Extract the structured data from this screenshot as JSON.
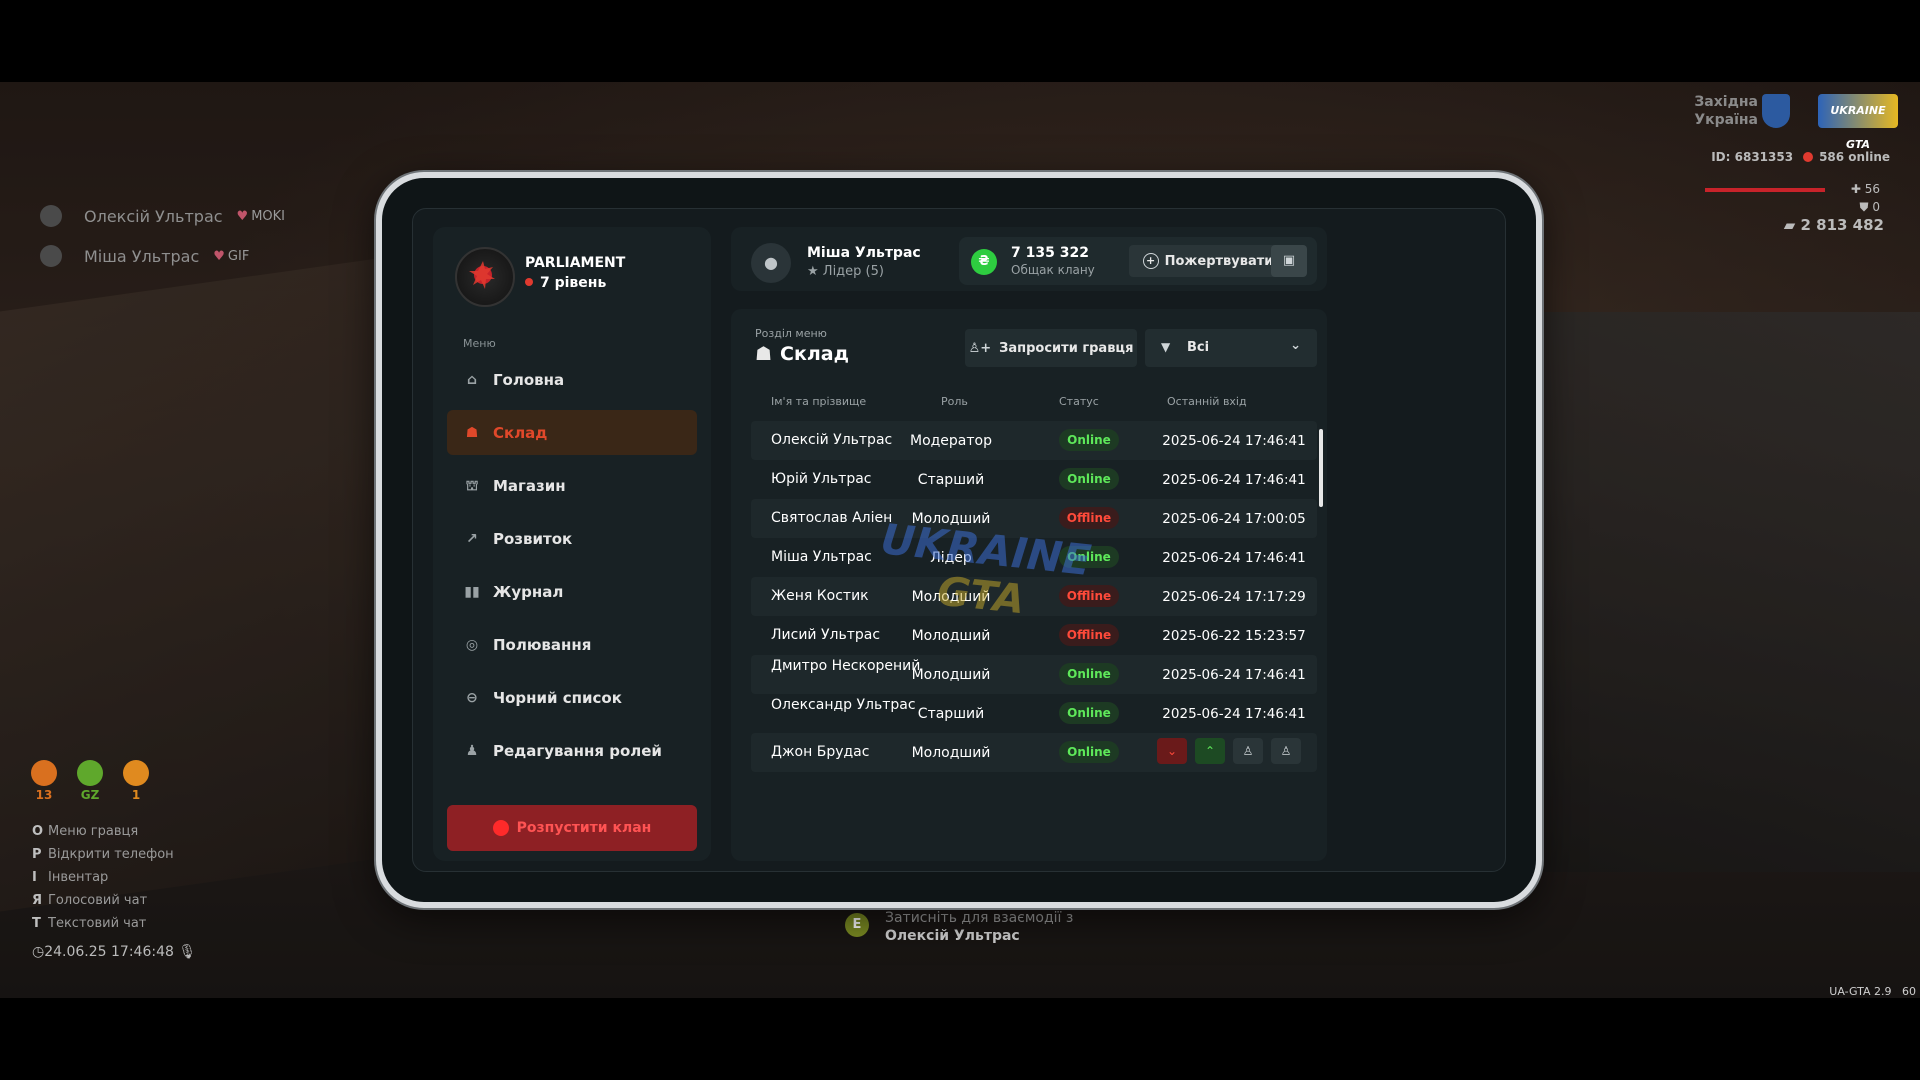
{
  "hud": {
    "region": "Західна\nУкраїна",
    "logo": "UKRAINE GTA",
    "player_id": "ID: 6831353",
    "online": "586 online",
    "health": "56",
    "armor": "0",
    "money": "2 813 482",
    "stats": [
      {
        "value": "13",
        "color": "#d9701f"
      },
      {
        "value": "GZ",
        "color": "#5fa82c"
      },
      {
        "value": "1",
        "color": "#e08a1f"
      }
    ],
    "keys": [
      {
        "key": "O",
        "label": "Меню гравця"
      },
      {
        "key": "P",
        "label": "Відкрити телефон"
      },
      {
        "key": "I",
        "label": "Інвентар"
      },
      {
        "key": "Я",
        "label": "Голосовий чат"
      },
      {
        "key": "T",
        "label": "Текстовий чат"
      }
    ],
    "clock": "24.06.25 17:46:48",
    "version": "UA-GTA 2.9   60"
  },
  "chat": [
    {
      "name": "Олексій Ультрас",
      "tag": "MOKI"
    },
    {
      "name": "Міша Ультрас",
      "tag": "GIF"
    }
  ],
  "prompt": {
    "key": "E",
    "line1": "Затисніть для взаємодії з",
    "line2": "Олексій Ультрас"
  },
  "clan": {
    "name": "PARLIAMENT",
    "level": "7 рівень"
  },
  "menu": {
    "label": "Меню",
    "items": [
      {
        "label": "Головна",
        "icon": "home-icon",
        "active": false
      },
      {
        "label": "Склад",
        "icon": "members-icon",
        "active": true
      },
      {
        "label": "Магазин",
        "icon": "shop-icon",
        "active": false
      },
      {
        "label": "Розвиток",
        "icon": "chart-icon",
        "active": false
      },
      {
        "label": "Журнал",
        "icon": "book-icon",
        "active": false
      },
      {
        "label": "Полювання",
        "icon": "target-icon",
        "active": false
      },
      {
        "label": "Чорний список",
        "icon": "block-icon",
        "active": false
      },
      {
        "label": "Редагування ролей",
        "icon": "user-edit-icon",
        "active": false
      }
    ],
    "disband": "Розпустити клан"
  },
  "player": {
    "name": "Міша Ультрас",
    "role": "Лідер (5)"
  },
  "treasury": {
    "value": "7 135 322",
    "label": "Общак клану",
    "donate": "Пожертвувати"
  },
  "section": {
    "label": "Розділ меню",
    "title": "Склад",
    "invite": "Запросити гравця",
    "filter": "Всі"
  },
  "table": {
    "headers": [
      "Ім'я та прізвище",
      "Роль",
      "Статус",
      "Останній вхід"
    ],
    "rows": [
      {
        "name": "Олексій Ультрас",
        "role": "Модератор",
        "status": "Online",
        "last": "2025-06-24 17:46:41"
      },
      {
        "name": "Юрій Ультрас",
        "role": "Старший",
        "status": "Online",
        "last": "2025-06-24 17:46:41"
      },
      {
        "name": "Святослав Аліен",
        "role": "Молодший",
        "status": "Offline",
        "last": "2025-06-24 17:00:05"
      },
      {
        "name": "Міша Ультрас",
        "role": "Лідер",
        "status": "Online",
        "last": "2025-06-24 17:46:41"
      },
      {
        "name": "Женя Костик",
        "role": "Молодший",
        "status": "Offline",
        "last": "2025-06-24 17:17:29"
      },
      {
        "name": "Лисий Ультрас",
        "role": "Молодший",
        "status": "Offline",
        "last": "2025-06-22 15:23:57"
      },
      {
        "name": "Дмитро Нескорений",
        "role": "Молодший",
        "status": "Online",
        "last": "2025-06-24 17:46:41"
      },
      {
        "name": "Олександр Ультрас",
        "role": "Старший",
        "status": "Online",
        "last": "2025-06-24 17:46:41"
      },
      {
        "name": "Джон Брудас",
        "role": "Молодший",
        "status": "Online",
        "last": ""
      }
    ]
  },
  "watermark": {
    "line1": "UKRAINE",
    "line2": "GTA"
  }
}
